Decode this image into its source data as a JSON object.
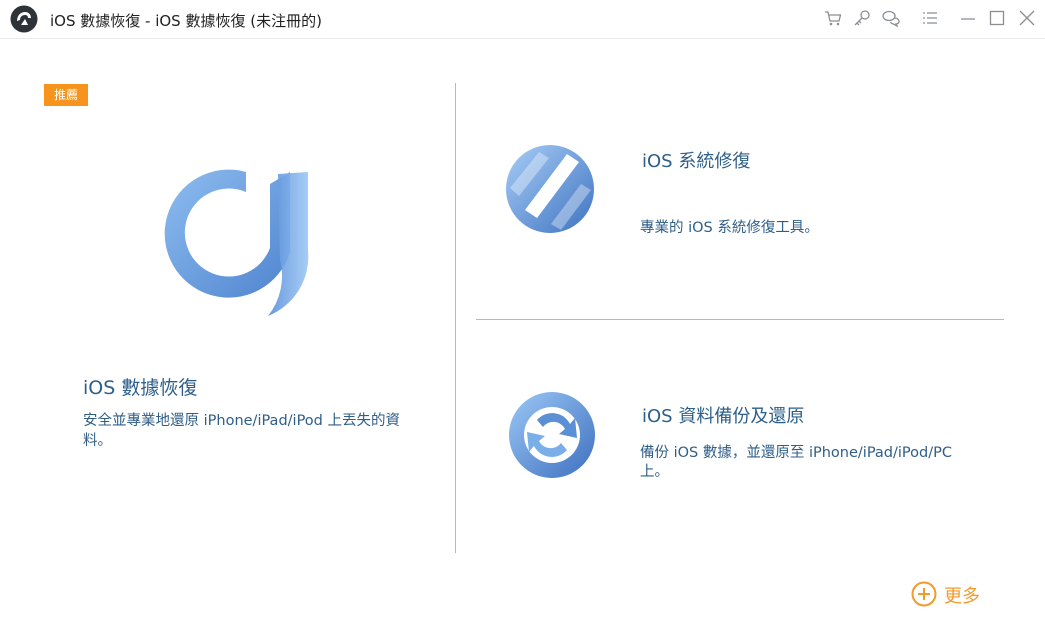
{
  "window": {
    "title": "iOS 數據恢復 - iOS 數據恢復 (未注冊的)",
    "toolbar_icons": [
      "cart-icon",
      "key-icon",
      "chat-icon",
      "menu-icon",
      "minimize-icon",
      "maximize-icon",
      "close-icon"
    ]
  },
  "main_feature": {
    "badge": "推薦",
    "title": "iOS 數據恢復",
    "description": "安全並專業地還原 iPhone/iPad/iPod 上丟失的資料。"
  },
  "features": [
    {
      "title": "iOS 系統修復",
      "description": "專業的 iOS 系統修復工具。",
      "icon": "system-repair-icon"
    },
    {
      "title": "iOS 資料備份及還原",
      "description": "備份 iOS 數據，並還原至 iPhone/iPad/iPod/PC 上。",
      "icon": "backup-restore-icon"
    }
  ],
  "more": {
    "label": "更多",
    "icon": "plus-circle-icon"
  },
  "colors": {
    "accent": "#f7941d",
    "text_blue": "#2d5f8a",
    "divider": "#9dbfd8",
    "icon_blue": "#5b8fd6"
  }
}
